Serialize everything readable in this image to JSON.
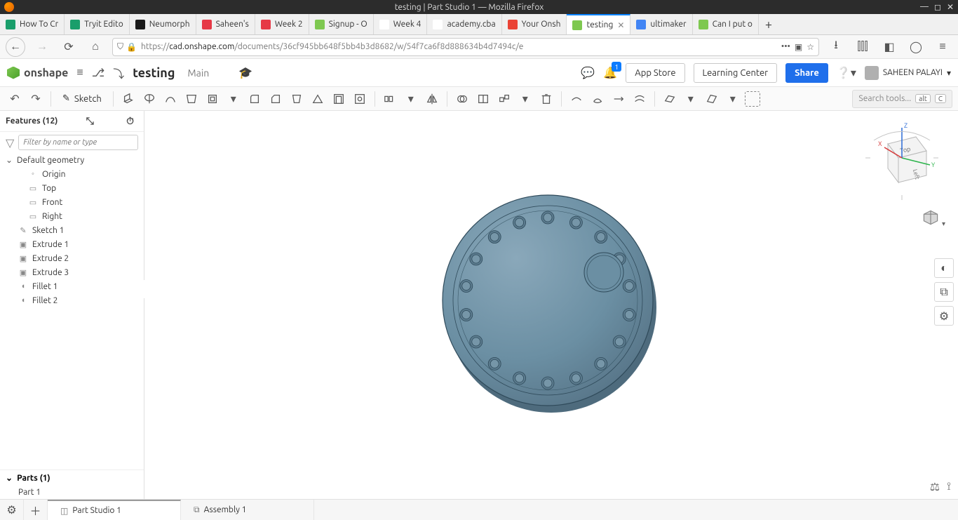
{
  "window": {
    "title": "testing | Part Studio 1 — Mozilla Firefox"
  },
  "tabs": [
    {
      "label": "How To Cr",
      "favicon": "#1a9e6b"
    },
    {
      "label": "Tryit Edito",
      "favicon": "#1a9e6b"
    },
    {
      "label": "Neumorph",
      "favicon": "#1a1a1a"
    },
    {
      "label": "Saheen's",
      "favicon": "#e63946"
    },
    {
      "label": "Week 2",
      "favicon": "#e63946"
    },
    {
      "label": "Signup - O",
      "favicon": "#7ec850"
    },
    {
      "label": "Week 4",
      "favicon": "#ffffff"
    },
    {
      "label": "academy.cba",
      "favicon": "#ffffff"
    },
    {
      "label": "Your Onsh",
      "favicon": "#ea4335"
    },
    {
      "label": "testing",
      "favicon": "#7ec850",
      "active": true
    },
    {
      "label": "ultimaker",
      "favicon": "#4285f4"
    },
    {
      "label": "Can I put o",
      "favicon": "#7ec850"
    }
  ],
  "url": {
    "prefix": "https://",
    "domain": "cad.onshape.com",
    "path": "/documents/36cf945bb648f5bb4b3d8682/w/54f7ca6f8d888634b4d7494c/e"
  },
  "header": {
    "brand": "onshape",
    "doc_name": "testing",
    "branch": "Main",
    "notifications_count": "1",
    "app_store": "App Store",
    "learning_center": "Learning Center",
    "share": "Share",
    "user_name": "SAHEEN PALAYI"
  },
  "toolbar": {
    "sketch_label": "Sketch",
    "search_placeholder": "Search tools...",
    "kbd_alt": "alt",
    "kbd_c": "C"
  },
  "feature_panel": {
    "title": "Features (12)",
    "filter_placeholder": "Filter by name or type",
    "default_geometry": "Default geometry",
    "items_geom": [
      "Origin",
      "Top",
      "Front",
      "Right"
    ],
    "items_features": [
      "Sketch 1",
      "Extrude 1",
      "Extrude 2",
      "Extrude 3",
      "Fillet 1",
      "Fillet 2"
    ],
    "parts_title": "Parts (1)",
    "parts": [
      "Part 1"
    ]
  },
  "bottom_tabs": {
    "part_studio": "Part Studio 1",
    "assembly": "Assembly 1"
  },
  "viewcube": {
    "top_label": "Top",
    "left_label": "Left",
    "x": "X",
    "y": "Y",
    "z": "Z"
  },
  "colors": {
    "accent_blue": "#1f6feb",
    "model_fill": "#6b8fa3",
    "model_stroke": "#2f4a5a"
  }
}
